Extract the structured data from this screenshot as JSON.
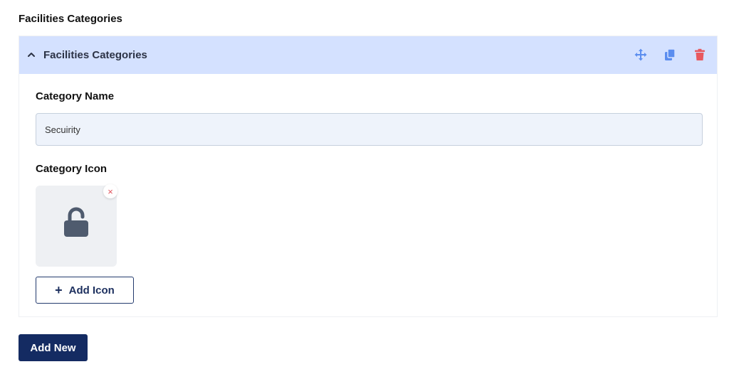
{
  "section": {
    "title": "Facilities Categories"
  },
  "repeater": {
    "header_title": "Facilities Categories",
    "icons": {
      "collapse": "chevron-up-icon",
      "move": "move-icon",
      "duplicate": "duplicate-icon",
      "delete": "trash-icon"
    },
    "category_name_label": "Category Name",
    "category_name_value": "Secuirity",
    "category_icon_label": "Category Icon",
    "category_icon": "lock-open-icon",
    "remove_symbol": "×",
    "add_icon_plus": "+",
    "add_icon_label": "Add Icon"
  },
  "add_new_label": "Add New",
  "colors": {
    "header_bg": "#d4e1ff",
    "accent_blue": "#5b8def",
    "delete_red": "#e8595f",
    "primary_navy": "#142b62",
    "icon_slate": "#4f5b6e"
  }
}
